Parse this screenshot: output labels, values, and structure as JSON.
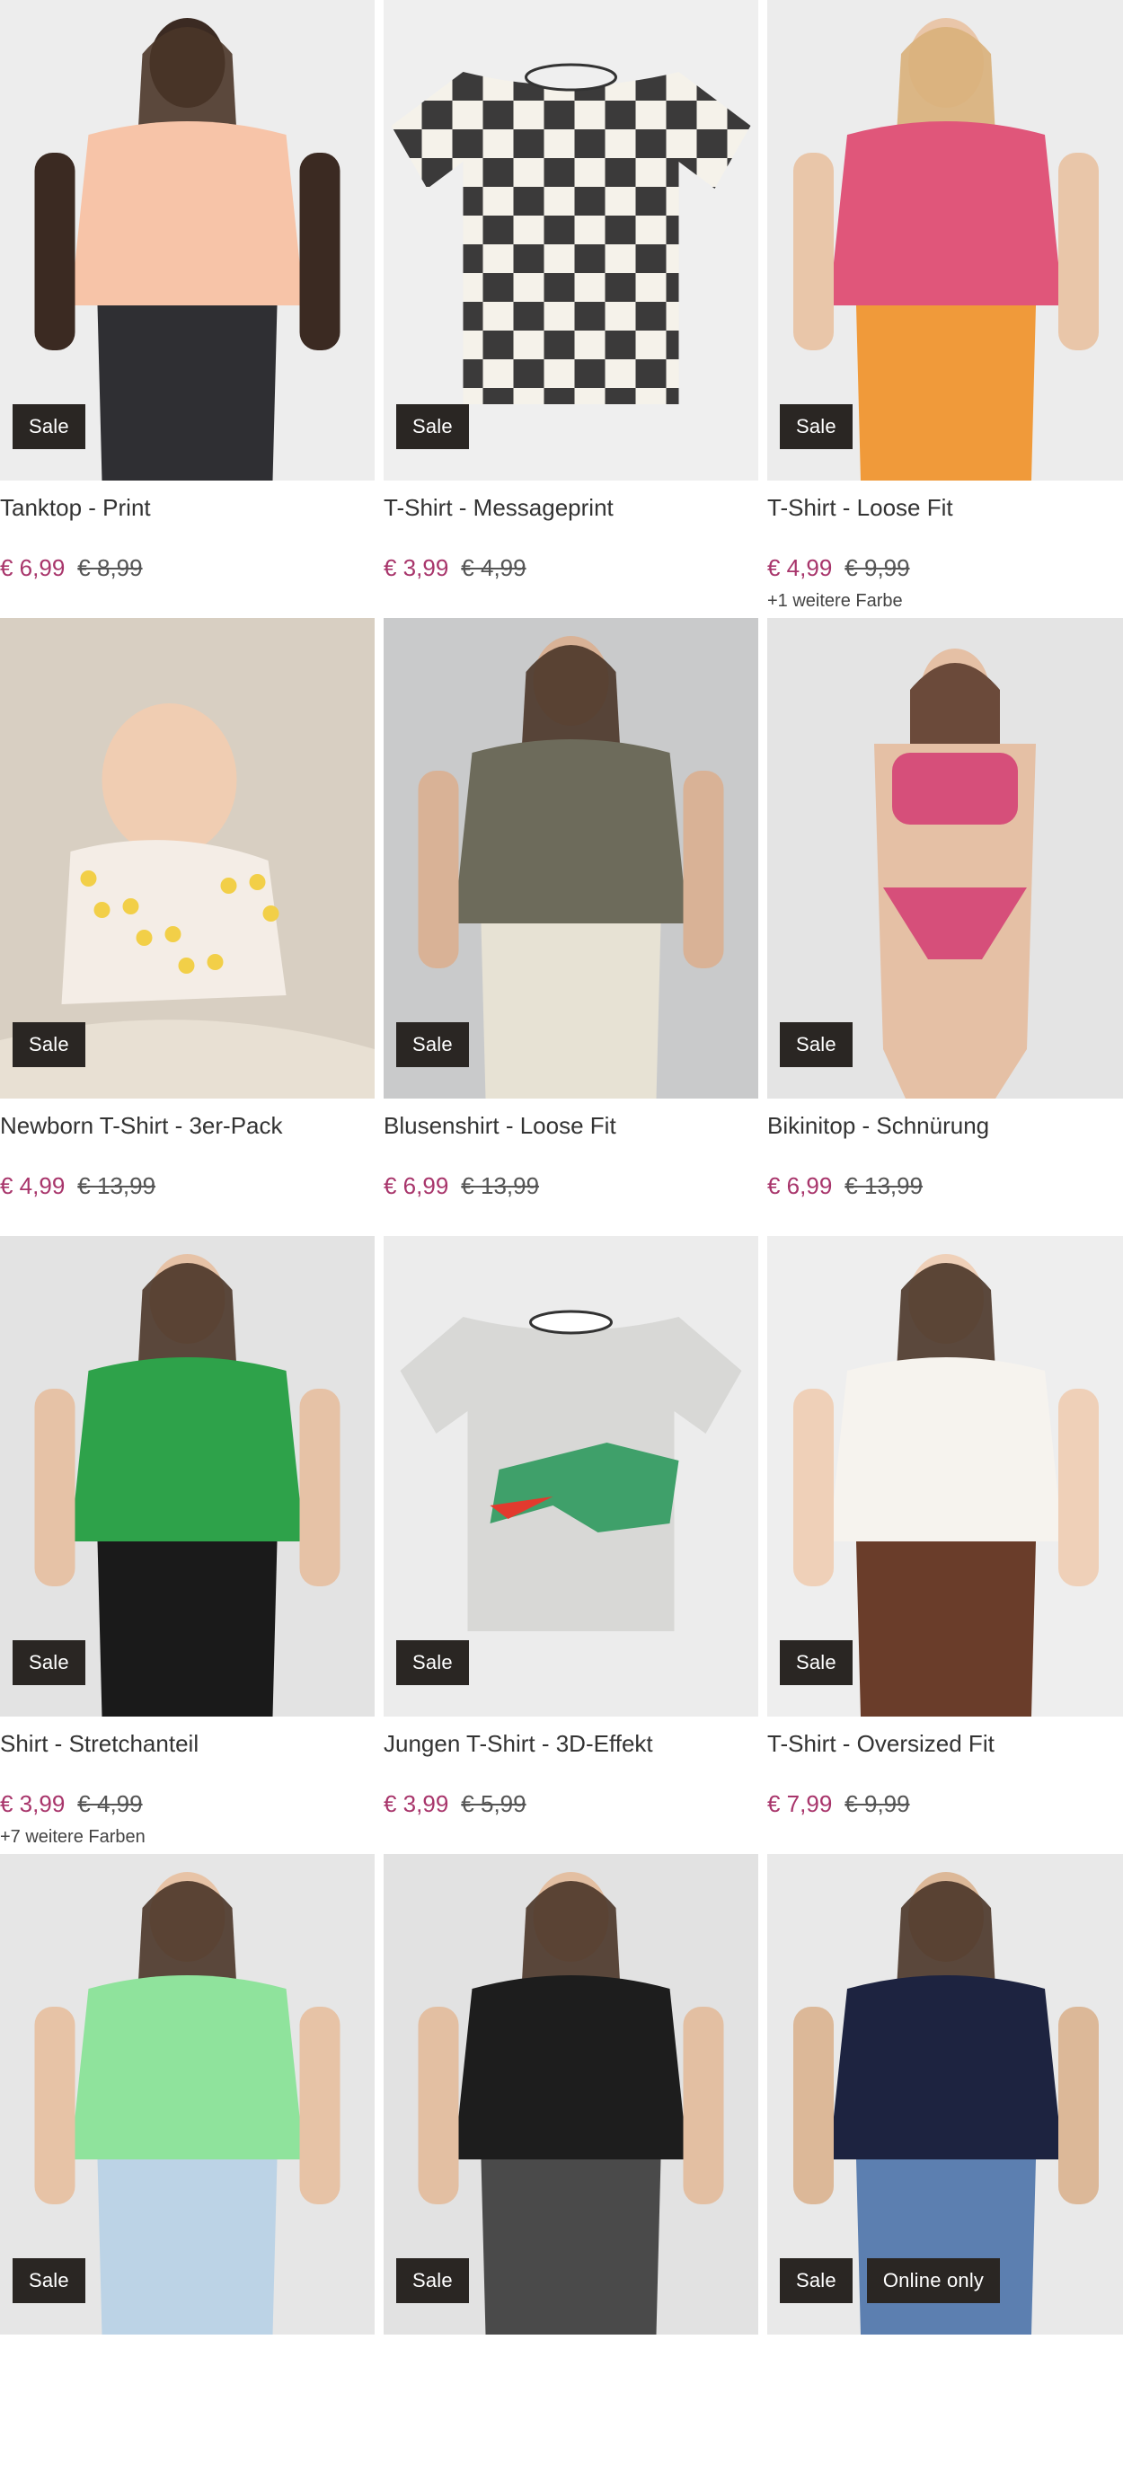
{
  "products": [
    {
      "title": "Tanktop - Print",
      "price": "€ 6,99",
      "old_price": "€ 8,99",
      "badges": [
        "Sale"
      ],
      "colors_note": ""
    },
    {
      "title": "T-Shirt - Messageprint",
      "price": "€ 3,99",
      "old_price": "€ 4,99",
      "badges": [
        "Sale"
      ],
      "colors_note": ""
    },
    {
      "title": "T-Shirt - Loose Fit",
      "price": "€ 4,99",
      "old_price": "€ 9,99",
      "badges": [
        "Sale"
      ],
      "colors_note": "+1 weitere Farbe"
    },
    {
      "title": "Newborn T-Shirt - 3er-Pack",
      "price": "€ 4,99",
      "old_price": "€ 13,99",
      "badges": [
        "Sale"
      ],
      "colors_note": ""
    },
    {
      "title": "Blusenshirt - Loose Fit",
      "price": "€ 6,99",
      "old_price": "€ 13,99",
      "badges": [
        "Sale"
      ],
      "colors_note": ""
    },
    {
      "title": "Bikinitop - Schnürung",
      "price": "€ 6,99",
      "old_price": "€ 13,99",
      "badges": [
        "Sale"
      ],
      "colors_note": ""
    },
    {
      "title": "Shirt - Stretchanteil",
      "price": "€ 3,99",
      "old_price": "€ 4,99",
      "badges": [
        "Sale"
      ],
      "colors_note": "+7 weitere Farben"
    },
    {
      "title": "Jungen T-Shirt - 3D-Effekt",
      "price": "€ 3,99",
      "old_price": "€ 5,99",
      "badges": [
        "Sale"
      ],
      "colors_note": ""
    },
    {
      "title": "T-Shirt - Oversized Fit",
      "price": "€ 7,99",
      "old_price": "€ 9,99",
      "badges": [
        "Sale"
      ],
      "colors_note": ""
    },
    {
      "title": "",
      "price": "",
      "old_price": "",
      "badges": [
        "Sale"
      ],
      "colors_note": ""
    },
    {
      "title": "",
      "price": "",
      "old_price": "",
      "badges": [
        "Sale"
      ],
      "colors_note": ""
    },
    {
      "title": "",
      "price": "",
      "old_price": "",
      "badges": [
        "Sale",
        "Online only"
      ],
      "colors_note": ""
    }
  ],
  "images": [
    {
      "bg": "#ededed",
      "garment": "#f7c4a8",
      "accent": "#2f2f33",
      "skin": "#3b2a22",
      "kind": "person"
    },
    {
      "bg": "#efefef",
      "garment": "#2a2a2a",
      "accent": "#f5f2ea",
      "skin": "",
      "kind": "flat-check"
    },
    {
      "bg": "#ececec",
      "garment": "#e0567a",
      "accent": "#f09a3a",
      "skin": "#e9c6a9",
      "kind": "person-back"
    },
    {
      "bg": "#d8cfc2",
      "garment": "#f4ede6",
      "accent": "#f2cf48",
      "skin": "#f0cdb2",
      "kind": "baby"
    },
    {
      "bg": "#c9cacb",
      "garment": "#6d6b5b",
      "accent": "#e7e2d4",
      "skin": "#d9b296",
      "kind": "person"
    },
    {
      "bg": "#e4e4e4",
      "garment": "#d64f7a",
      "accent": "#d64f7a",
      "skin": "#e5c0a5",
      "kind": "bikini"
    },
    {
      "bg": "#e3e3e3",
      "garment": "#2ea24a",
      "accent": "#1a1a1a",
      "skin": "#e6c2a6",
      "kind": "person"
    },
    {
      "bg": "#ececec",
      "garment": "#d8d8d6",
      "accent": "#3fa06a",
      "skin": "",
      "kind": "flat-croc"
    },
    {
      "bg": "#eeeeee",
      "garment": "#f6f3ee",
      "accent": "#6a3d2a",
      "skin": "#efd0b8",
      "kind": "person"
    },
    {
      "bg": "#e6e6e6",
      "garment": "#8fe39c",
      "accent": "#bcd3e6",
      "skin": "#e7c3a6",
      "kind": "person"
    },
    {
      "bg": "#e2e2e2",
      "garment": "#1d1d1d",
      "accent": "#4a4a4a",
      "skin": "#e3bfa2",
      "kind": "person"
    },
    {
      "bg": "#e9e9e9",
      "garment": "#1d2340",
      "accent": "#5c7fb0",
      "skin": "#dcb898",
      "kind": "person"
    }
  ]
}
